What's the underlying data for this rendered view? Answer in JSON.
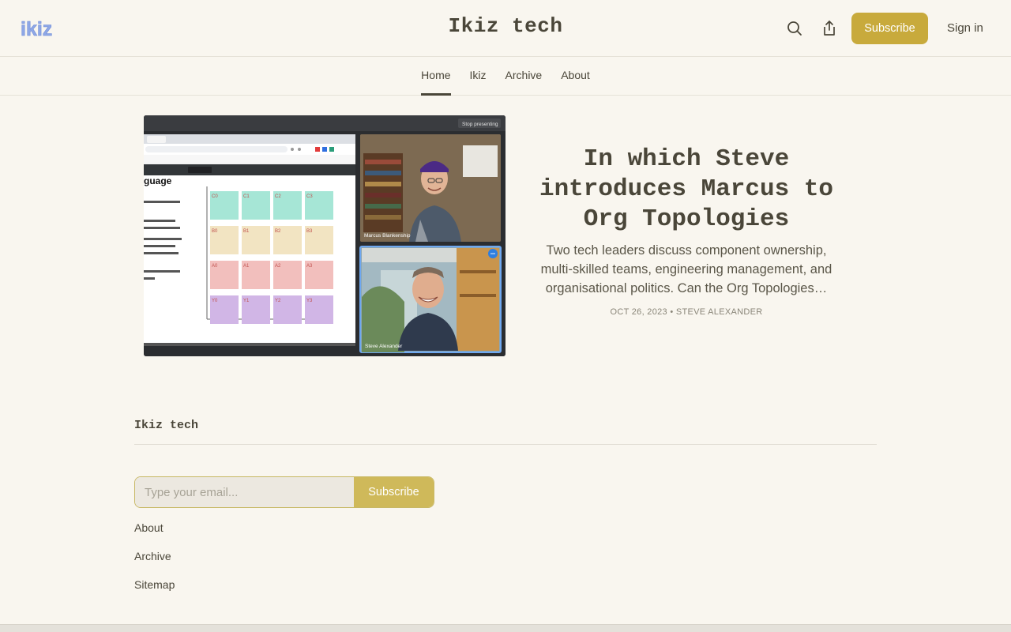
{
  "header": {
    "logo_text": "ikiz",
    "site_title": "Ikiz tech",
    "subscribe_label": "Subscribe",
    "signin_label": "Sign in"
  },
  "nav": {
    "items": [
      {
        "label": "Home",
        "active": true
      },
      {
        "label": "Ikiz",
        "active": false
      },
      {
        "label": "Archive",
        "active": false
      },
      {
        "label": "About",
        "active": false
      }
    ]
  },
  "post": {
    "title": "In which Steve introduces Marcus to Org Topologies",
    "description": "Two tech leaders discuss component ownership, multi-skilled teams, engineering management, and organisational politics. Can the Org Topologies…",
    "date": "OCT 26, 2023",
    "separator": "•",
    "author": "STEVE ALEXANDER",
    "image": {
      "stop_presenting": "Stop presenting",
      "heading_fragment": "guage",
      "participant_1": "Marcus Blankenship",
      "participant_2": "Steve Alexander",
      "grid_rows": [
        {
          "labels": [
            "C0",
            "C1",
            "C2",
            "C3"
          ],
          "color": "#a6e6d6"
        },
        {
          "labels": [
            "B0",
            "B1",
            "B2",
            "B3"
          ],
          "color": "#f2e4c2"
        },
        {
          "labels": [
            "A0",
            "A1",
            "A2",
            "A3"
          ],
          "color": "#f2bfbd"
        },
        {
          "labels": [
            "Y0",
            "Y1",
            "Y2",
            "Y3"
          ],
          "color": "#d1b6e6"
        }
      ]
    }
  },
  "footer": {
    "title": "Ikiz tech",
    "email_placeholder": "Type your email...",
    "subscribe_label": "Subscribe",
    "links": [
      "About",
      "Archive",
      "Sitemap"
    ]
  },
  "colors": {
    "accent": "#c8aa3c",
    "background": "#f9f6ef",
    "text": "#4a4639"
  }
}
